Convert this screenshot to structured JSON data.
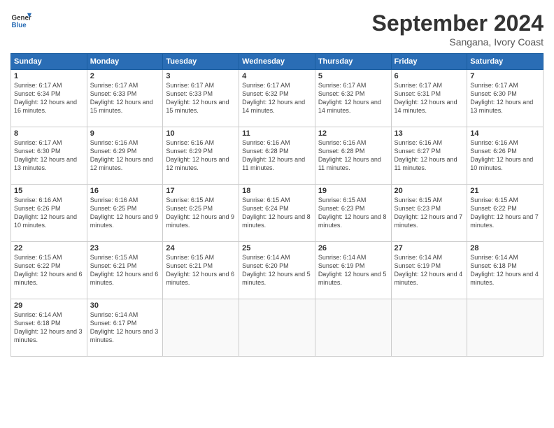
{
  "header": {
    "logo_general": "General",
    "logo_blue": "Blue",
    "title": "September 2024",
    "location": "Sangana, Ivory Coast"
  },
  "days_of_week": [
    "Sunday",
    "Monday",
    "Tuesday",
    "Wednesday",
    "Thursday",
    "Friday",
    "Saturday"
  ],
  "weeks": [
    [
      {
        "day": 1,
        "sunrise": "6:17 AM",
        "sunset": "6:34 PM",
        "daylight": "12 hours and 16 minutes."
      },
      {
        "day": 2,
        "sunrise": "6:17 AM",
        "sunset": "6:33 PM",
        "daylight": "12 hours and 15 minutes."
      },
      {
        "day": 3,
        "sunrise": "6:17 AM",
        "sunset": "6:33 PM",
        "daylight": "12 hours and 15 minutes."
      },
      {
        "day": 4,
        "sunrise": "6:17 AM",
        "sunset": "6:32 PM",
        "daylight": "12 hours and 14 minutes."
      },
      {
        "day": 5,
        "sunrise": "6:17 AM",
        "sunset": "6:32 PM",
        "daylight": "12 hours and 14 minutes."
      },
      {
        "day": 6,
        "sunrise": "6:17 AM",
        "sunset": "6:31 PM",
        "daylight": "12 hours and 14 minutes."
      },
      {
        "day": 7,
        "sunrise": "6:17 AM",
        "sunset": "6:30 PM",
        "daylight": "12 hours and 13 minutes."
      }
    ],
    [
      {
        "day": 8,
        "sunrise": "6:17 AM",
        "sunset": "6:30 PM",
        "daylight": "12 hours and 13 minutes."
      },
      {
        "day": 9,
        "sunrise": "6:16 AM",
        "sunset": "6:29 PM",
        "daylight": "12 hours and 12 minutes."
      },
      {
        "day": 10,
        "sunrise": "6:16 AM",
        "sunset": "6:29 PM",
        "daylight": "12 hours and 12 minutes."
      },
      {
        "day": 11,
        "sunrise": "6:16 AM",
        "sunset": "6:28 PM",
        "daylight": "12 hours and 11 minutes."
      },
      {
        "day": 12,
        "sunrise": "6:16 AM",
        "sunset": "6:28 PM",
        "daylight": "12 hours and 11 minutes."
      },
      {
        "day": 13,
        "sunrise": "6:16 AM",
        "sunset": "6:27 PM",
        "daylight": "12 hours and 11 minutes."
      },
      {
        "day": 14,
        "sunrise": "6:16 AM",
        "sunset": "6:26 PM",
        "daylight": "12 hours and 10 minutes."
      }
    ],
    [
      {
        "day": 15,
        "sunrise": "6:16 AM",
        "sunset": "6:26 PM",
        "daylight": "12 hours and 10 minutes."
      },
      {
        "day": 16,
        "sunrise": "6:16 AM",
        "sunset": "6:25 PM",
        "daylight": "12 hours and 9 minutes."
      },
      {
        "day": 17,
        "sunrise": "6:15 AM",
        "sunset": "6:25 PM",
        "daylight": "12 hours and 9 minutes."
      },
      {
        "day": 18,
        "sunrise": "6:15 AM",
        "sunset": "6:24 PM",
        "daylight": "12 hours and 8 minutes."
      },
      {
        "day": 19,
        "sunrise": "6:15 AM",
        "sunset": "6:23 PM",
        "daylight": "12 hours and 8 minutes."
      },
      {
        "day": 20,
        "sunrise": "6:15 AM",
        "sunset": "6:23 PM",
        "daylight": "12 hours and 7 minutes."
      },
      {
        "day": 21,
        "sunrise": "6:15 AM",
        "sunset": "6:22 PM",
        "daylight": "12 hours and 7 minutes."
      }
    ],
    [
      {
        "day": 22,
        "sunrise": "6:15 AM",
        "sunset": "6:22 PM",
        "daylight": "12 hours and 6 minutes."
      },
      {
        "day": 23,
        "sunrise": "6:15 AM",
        "sunset": "6:21 PM",
        "daylight": "12 hours and 6 minutes."
      },
      {
        "day": 24,
        "sunrise": "6:15 AM",
        "sunset": "6:21 PM",
        "daylight": "12 hours and 6 minutes."
      },
      {
        "day": 25,
        "sunrise": "6:14 AM",
        "sunset": "6:20 PM",
        "daylight": "12 hours and 5 minutes."
      },
      {
        "day": 26,
        "sunrise": "6:14 AM",
        "sunset": "6:19 PM",
        "daylight": "12 hours and 5 minutes."
      },
      {
        "day": 27,
        "sunrise": "6:14 AM",
        "sunset": "6:19 PM",
        "daylight": "12 hours and 4 minutes."
      },
      {
        "day": 28,
        "sunrise": "6:14 AM",
        "sunset": "6:18 PM",
        "daylight": "12 hours and 4 minutes."
      }
    ],
    [
      {
        "day": 29,
        "sunrise": "6:14 AM",
        "sunset": "6:18 PM",
        "daylight": "12 hours and 3 minutes."
      },
      {
        "day": 30,
        "sunrise": "6:14 AM",
        "sunset": "6:17 PM",
        "daylight": "12 hours and 3 minutes."
      },
      null,
      null,
      null,
      null,
      null
    ]
  ]
}
